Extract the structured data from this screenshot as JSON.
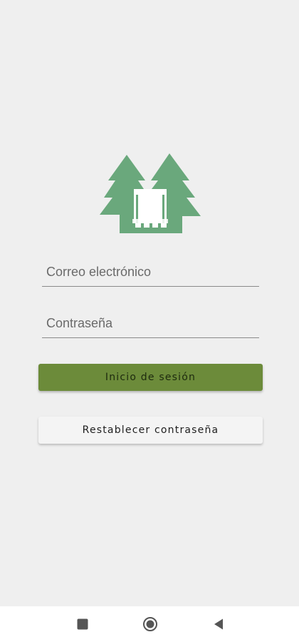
{
  "login": {
    "email_placeholder": "Correo electrónico",
    "password_placeholder": "Contraseña",
    "login_button_label": "Inicio de sesión",
    "reset_button_label": "Restablecer contraseña"
  },
  "logo": {
    "icon": "forest-truck-logo",
    "color": "#6aa87c"
  },
  "navbar": {
    "recents_icon": "square-icon",
    "home_icon": "circle-icon",
    "back_icon": "triangle-back-icon"
  },
  "colors": {
    "background": "#efefef",
    "primary_button": "#6c8b3a",
    "secondary_button": "#f4f4f4"
  }
}
